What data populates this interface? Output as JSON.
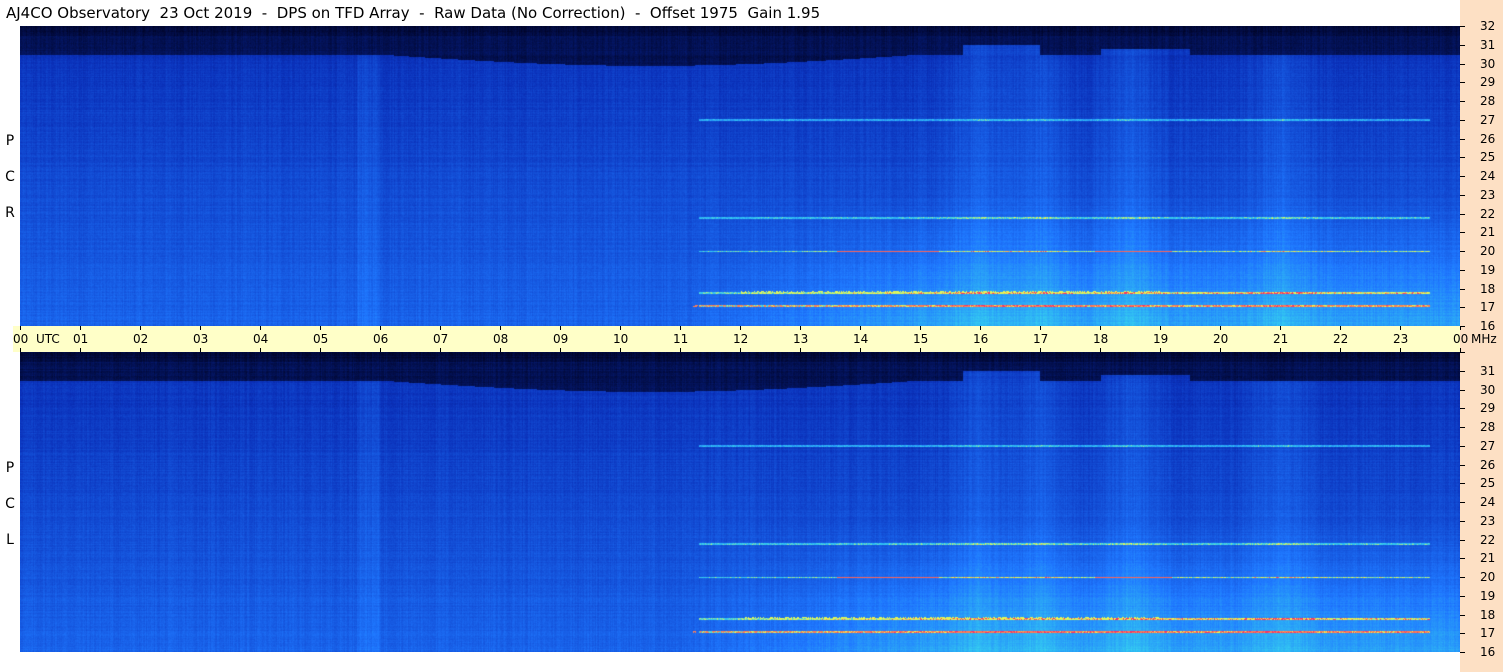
{
  "title": "AJ4CO Observatory  23 Oct 2019  -  DPS on TFD Array  -  Raw Data (No Correction)  -  Offset 1975  Gain 1.95",
  "panels": [
    {
      "id": "rcp",
      "label_letters": [
        "R",
        "C",
        "P"
      ]
    },
    {
      "id": "lcp",
      "label_letters": [
        "L",
        "C",
        "P"
      ]
    }
  ],
  "chart_data": {
    "type": "heatmap",
    "title": "AJ4CO Observatory  23 Oct 2019  -  DPS on TFD Array  -  Raw Data (No Correction)  -  Offset 1975  Gain 1.95",
    "x_unit": "UTC",
    "y_unit": "MHz",
    "x_range": [
      0,
      24
    ],
    "y_range": [
      16,
      32
    ],
    "x_tick_labels": [
      "00",
      "01",
      "02",
      "03",
      "04",
      "05",
      "06",
      "07",
      "08",
      "09",
      "10",
      "11",
      "12",
      "13",
      "14",
      "15",
      "16",
      "17",
      "18",
      "19",
      "20",
      "21",
      "22",
      "23",
      "00"
    ],
    "y_tick_labels": [
      "32",
      "31",
      "30",
      "29",
      "28",
      "27",
      "26",
      "25",
      "24",
      "23",
      "22",
      "21",
      "20",
      "19",
      "18",
      "17",
      "16"
    ],
    "series": [
      {
        "name": "RCP",
        "description_of_features": "dark band above ~30.5 MHz, bright activity 12-23 UTC below 23 MHz"
      },
      {
        "name": "LCP",
        "description_of_features": "dark band above ~30.5 MHz, bright activity 12-23 UTC below 23 MHz"
      }
    ],
    "colors": {
      "dark": "#000428",
      "low": "#0a2fb8",
      "mid": "#1f78ff",
      "high": "#35d0f0",
      "peak": "#ffff40",
      "hot": "#ff3060"
    },
    "features": {
      "dark_top_edge_mhz": 30.5,
      "bright_bursts_utc": [
        16,
        17,
        18.5,
        21
      ],
      "lines_mhz": [
        17.1,
        17.8,
        20,
        21.8,
        27
      ]
    }
  }
}
